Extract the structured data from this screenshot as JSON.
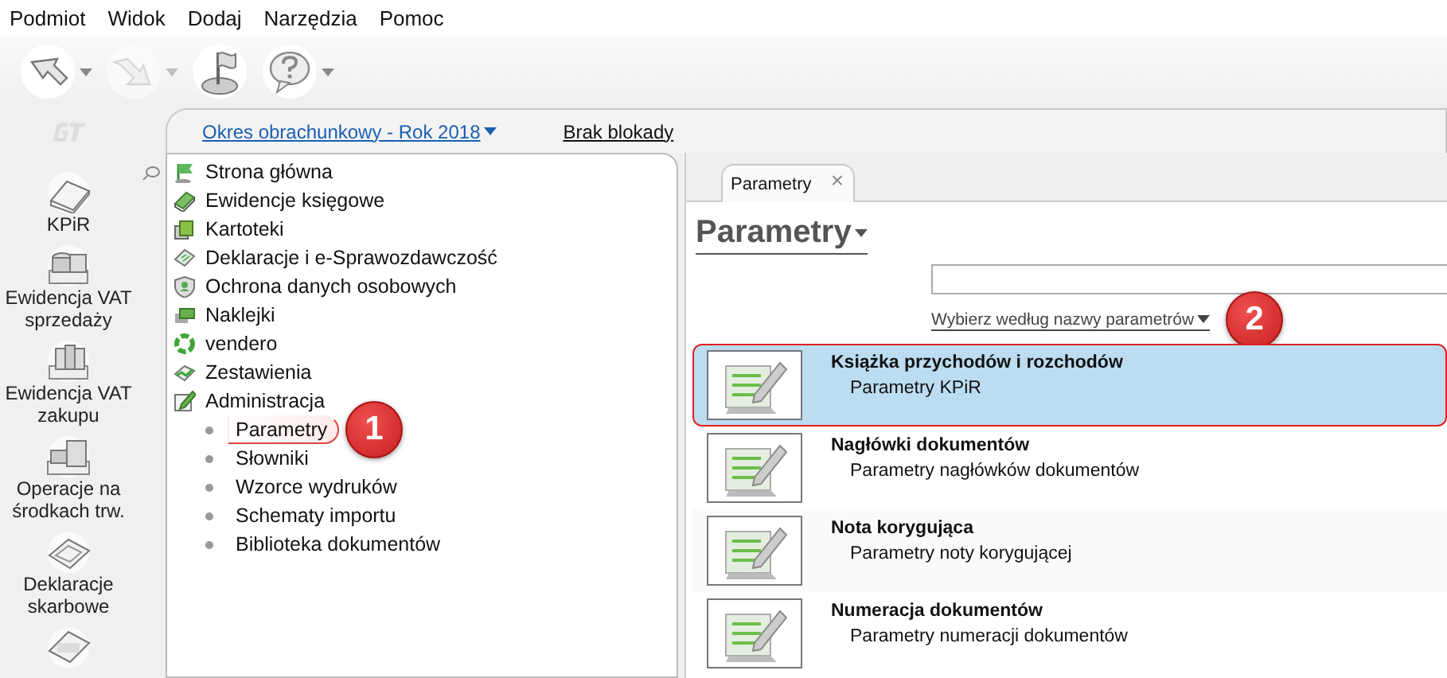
{
  "menu": [
    "Podmiot",
    "Widok",
    "Dodaj",
    "Narzędzia",
    "Pomoc"
  ],
  "toolbar": [
    {
      "kind": "back",
      "caret": true,
      "disabled": false
    },
    {
      "kind": "forward",
      "caret": true,
      "disabled": true
    },
    {
      "kind": "flag",
      "caret": false,
      "disabled": false
    },
    {
      "kind": "help",
      "caret": true,
      "disabled": false
    }
  ],
  "nav": [
    {
      "kind": "book",
      "label": "KPiR"
    },
    {
      "kind": "coins",
      "label": "Ewidencja VAT sprzedaży"
    },
    {
      "kind": "binders",
      "label": "Ewidencja VAT zakupu"
    },
    {
      "kind": "cabinet",
      "label": "Operacje na środkach trw."
    },
    {
      "kind": "tray",
      "label": "Deklaracje skarbowe"
    },
    {
      "kind": "jpk"
    }
  ],
  "header": {
    "period": "Okres obrachunkowy - Rok 2018",
    "lock": "Brak blokady"
  },
  "tree": [
    {
      "kind": "flag",
      "label": "Strona główna"
    },
    {
      "kind": "book",
      "label": "Ewidencje księgowe"
    },
    {
      "kind": "cards",
      "label": "Kartoteki"
    },
    {
      "kind": "form",
      "label": "Deklaracje i e-Sprawozdawczość"
    },
    {
      "kind": "shield",
      "label": "Ochrona danych osobowych"
    },
    {
      "kind": "stickers",
      "label": "Naklejki"
    },
    {
      "kind": "ring",
      "label": "vendero"
    },
    {
      "kind": "chart",
      "label": "Zestawienia"
    },
    {
      "kind": "edit",
      "label": "Administracja",
      "children": [
        {
          "label": "Parametry",
          "selected": true
        },
        {
          "label": "Słowniki",
          "selected": false
        },
        {
          "label": "Wzorce wydruków",
          "selected": false
        },
        {
          "label": "Schematy importu",
          "selected": false
        },
        {
          "label": "Biblioteka dokumentów",
          "selected": false
        }
      ]
    }
  ],
  "tabs": [
    {
      "label": "Parametry",
      "close": "×",
      "selected": true
    }
  ],
  "page_title": "Parametry",
  "filter_link": "Wybierz według nazwy parametrów",
  "params": [
    {
      "title": "Książka przychodów i rozchodów",
      "subtitle": "Parametry KPiR",
      "selected": true
    },
    {
      "title": "Nagłówki dokumentów",
      "subtitle": "Parametry nagłówków dokumentów",
      "selected": false
    },
    {
      "title": "Nota korygująca",
      "subtitle": "Parametry noty korygującej",
      "selected": false
    },
    {
      "title": "Numeracja dokumentów",
      "subtitle": "Parametry numeracji dokumentów",
      "selected": false
    }
  ],
  "callouts": [
    {
      "label": "1"
    },
    {
      "label": "2"
    }
  ]
}
